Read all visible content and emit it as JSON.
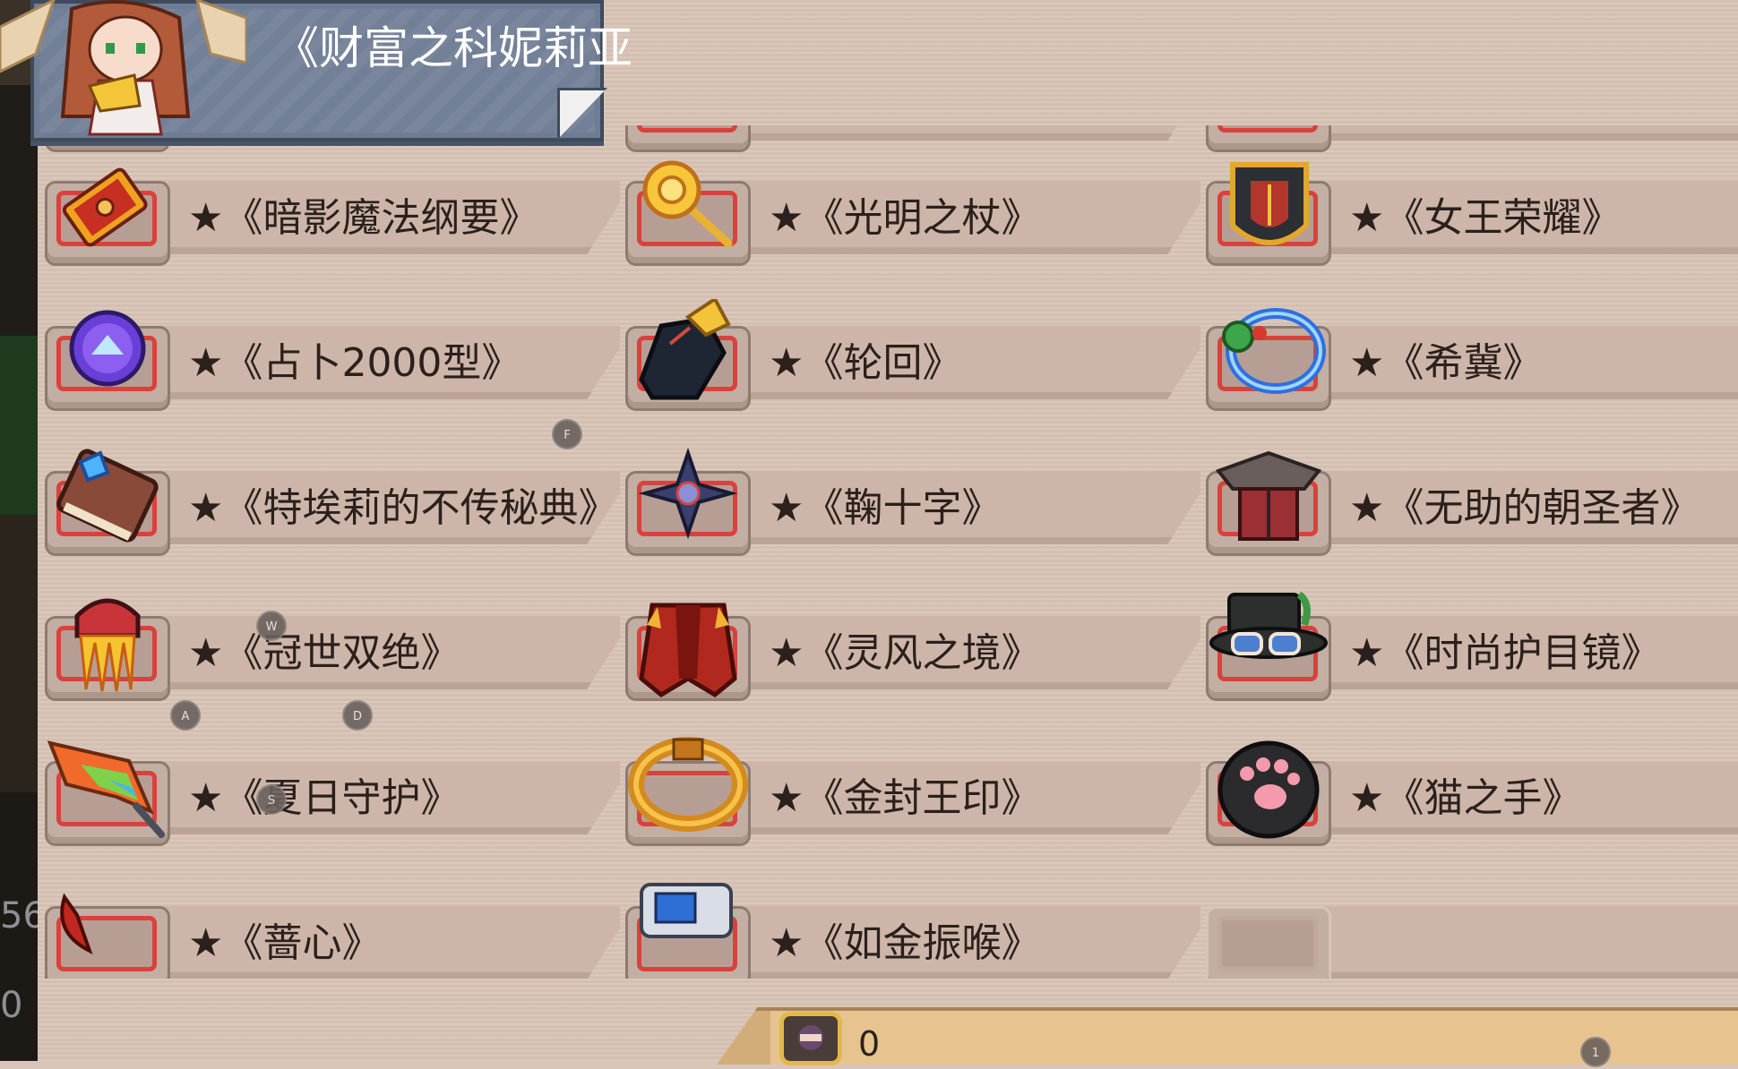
{
  "title_banner": {
    "title": "《财富之科妮莉亚",
    "character": "cornelia-portrait-icon"
  },
  "left_strip": {
    "number_a": "56",
    "number_b": "0"
  },
  "items": [
    [
      {
        "name": "★《暗影魔法纲要》",
        "icon": "spellbook-icon"
      },
      {
        "name": "★《光明之杖》",
        "icon": "sun-staff-icon"
      },
      {
        "name": "★《女王荣耀》",
        "icon": "royal-shield-icon"
      }
    ],
    [
      {
        "name": "★《占卜2000型》",
        "icon": "crystal-ball-icon"
      },
      {
        "name": "★《轮回》",
        "icon": "clawed-gauntlet-icon"
      },
      {
        "name": "★《希冀》",
        "icon": "blue-ring-icon"
      }
    ],
    [
      {
        "name": "★《特埃莉的不传秘典》",
        "icon": "brown-tome-icon"
      },
      {
        "name": "★《鞠十字》",
        "icon": "cross-shuriken-icon"
      },
      {
        "name": "★《无助的朝圣者》",
        "icon": "samurai-armor-icon"
      }
    ],
    [
      {
        "name": "★《冠世双绝》",
        "icon": "flame-helmet-icon"
      },
      {
        "name": "★《灵风之境》",
        "icon": "red-cloak-icon"
      },
      {
        "name": "★《时尚护目镜》",
        "icon": "goggles-hat-icon"
      }
    ],
    [
      {
        "name": "★《夏日守护》",
        "icon": "rainbow-blade-icon"
      },
      {
        "name": "★《金封王印》",
        "icon": "gold-ring-icon"
      },
      {
        "name": "★《猫之手》",
        "icon": "cat-paw-icon"
      }
    ],
    [
      {
        "name": "★《蔷心》",
        "icon": "red-scythe-icon"
      },
      {
        "name": "★《如金振喉》",
        "icon": "robot-head-icon"
      },
      {
        "name": "",
        "icon": "empty-slot"
      }
    ]
  ],
  "key_hints": {
    "f": "F",
    "w": "W",
    "a": "A",
    "d": "D",
    "s": "S",
    "one": "1"
  },
  "currency": {
    "amount": "0",
    "icon": "character-coin-icon"
  },
  "colors": {
    "slot_frame": "#d9423c",
    "panel": "#d8c4b6",
    "banner": "#6f7d94",
    "bar": "#e6c38f"
  }
}
